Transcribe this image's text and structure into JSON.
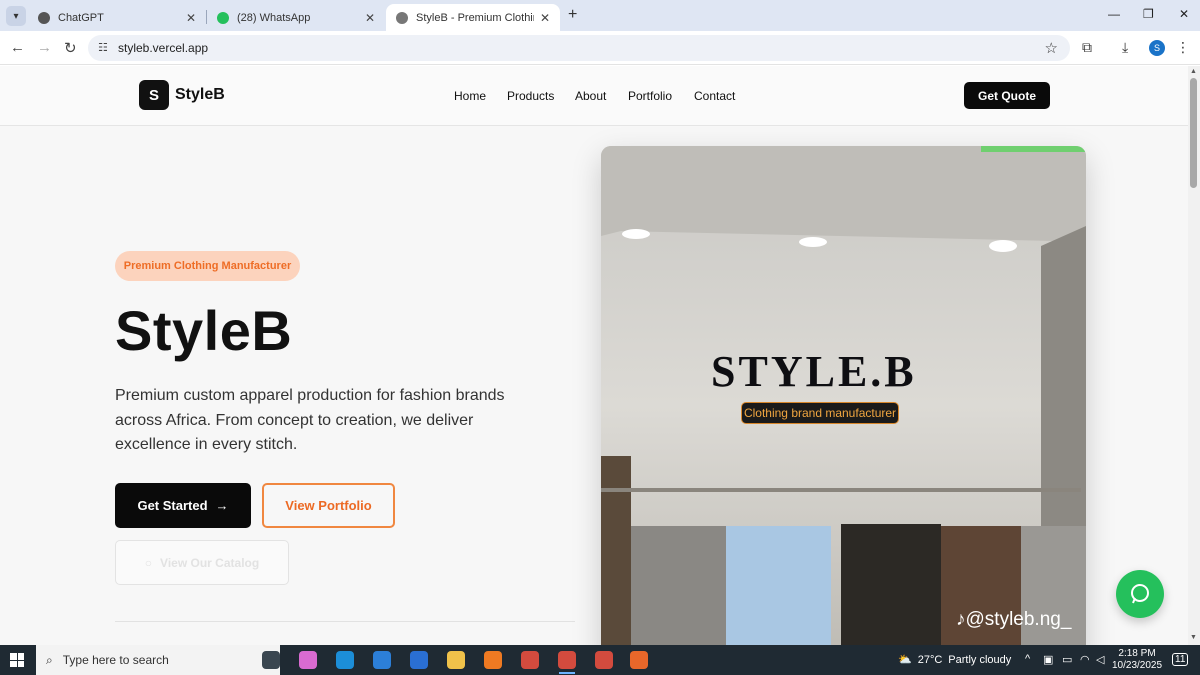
{
  "browser": {
    "tabs": [
      {
        "title": "ChatGPT",
        "active": false
      },
      {
        "title": "(28) WhatsApp",
        "active": false
      },
      {
        "title": "StyleB - Premium Clothing Man",
        "active": true
      }
    ],
    "url": "styleb.vercel.app",
    "profile_initial": "S"
  },
  "site": {
    "logo_mark": "S",
    "logo_text": "StyleB",
    "nav": [
      "Home",
      "Products",
      "About",
      "Portfolio",
      "Contact"
    ],
    "cta": "Get Quote"
  },
  "hero": {
    "badge": "Premium Clothing Manufacturer",
    "title": "StyleB",
    "description": "Premium custom apparel production for fashion brands across Africa. From concept to creation, we deliver excellence in every stitch.",
    "primary_button": "Get Started",
    "secondary_button": "View Portfolio",
    "catalog_button": "View Our Catalog",
    "image": {
      "sign": "STYLE.B",
      "subsign": "Clothing brand manufacturer",
      "handle": "@styleb.ng_"
    }
  },
  "taskbar": {
    "search_placeholder": "Type here to search",
    "weather_temp": "27°C",
    "weather_text": "Partly cloudy",
    "time": "2:18 PM",
    "date": "10/23/2025",
    "notification_count": "11"
  },
  "colors": {
    "accent_orange": "#ec6a24",
    "badge_bg": "#fcd3bd",
    "whatsapp_green": "#25c05c",
    "primary_dark": "#0a0a0a"
  }
}
